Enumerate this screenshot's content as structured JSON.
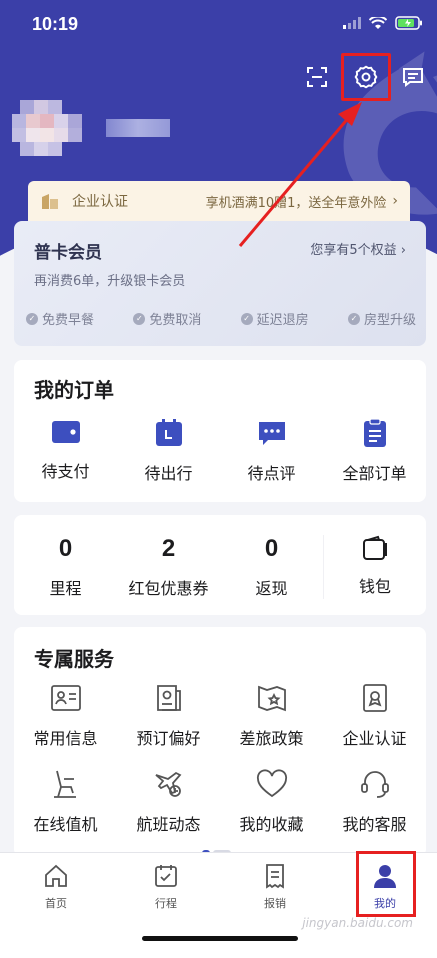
{
  "status": {
    "time": "10:19"
  },
  "cert": {
    "label": "企业认证",
    "promo": "享机酒满10赠1，送全年意外险"
  },
  "member": {
    "level": "普卡会员",
    "benefits": "您享有5个权益",
    "progress": "再消费6单，升级银卡会员",
    "perks": [
      "免费早餐",
      "免费取消",
      "延迟退房",
      "房型升级"
    ]
  },
  "orders": {
    "title": "我的订单",
    "items": [
      {
        "label": "待支付",
        "icon": "wallet-icon"
      },
      {
        "label": "待出行",
        "icon": "calendar-icon"
      },
      {
        "label": "待点评",
        "icon": "chat-icon"
      },
      {
        "label": "全部订单",
        "icon": "clipboard-icon"
      }
    ]
  },
  "stats": {
    "items": [
      {
        "value": "0",
        "label": "里程"
      },
      {
        "value": "2",
        "label": "红包优惠券"
      },
      {
        "value": "0",
        "label": "返现"
      }
    ],
    "wallet_label": "钱包"
  },
  "services": {
    "title": "专属服务",
    "items": [
      {
        "label": "常用信息",
        "icon": "id-card-icon"
      },
      {
        "label": "预订偏好",
        "icon": "preference-icon"
      },
      {
        "label": "差旅政策",
        "icon": "policy-icon"
      },
      {
        "label": "企业认证",
        "icon": "certificate-icon"
      },
      {
        "label": "在线值机",
        "icon": "seat-icon"
      },
      {
        "label": "航班动态",
        "icon": "flight-icon"
      },
      {
        "label": "我的收藏",
        "icon": "heart-icon"
      },
      {
        "label": "我的客服",
        "icon": "headset-icon"
      }
    ]
  },
  "tabs": [
    {
      "label": "首页",
      "icon": "home-icon"
    },
    {
      "label": "行程",
      "icon": "itinerary-icon"
    },
    {
      "label": "报销",
      "icon": "reimburse-icon"
    },
    {
      "label": "我的",
      "icon": "profile-icon",
      "active": true
    }
  ],
  "watermark": "jingyan.baidu.com",
  "colors": {
    "brand": "#3b3fa8",
    "highlight": "#e62020",
    "cert_bg": "#fbf3e5",
    "icon_blue": "#3d4fbf"
  }
}
